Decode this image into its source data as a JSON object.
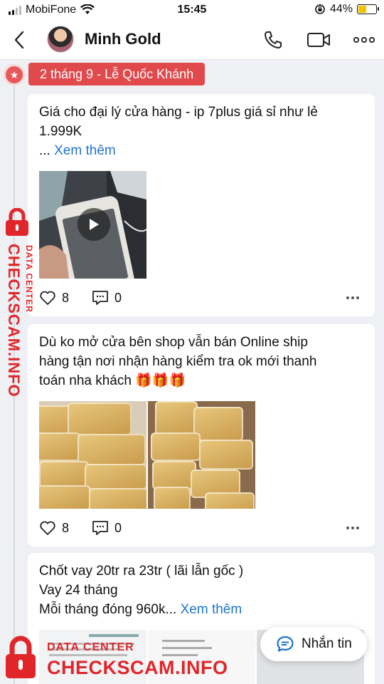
{
  "status_bar": {
    "carrier": "MobiFone",
    "time": "15:45",
    "battery": "44%"
  },
  "header": {
    "contact_name": "Minh Gold"
  },
  "timeline": {
    "date_label": "2 tháng 9 - Lễ Quốc Khánh"
  },
  "posts": [
    {
      "text_line1": "Giá cho đại lý cửa hàng - ip 7plus giá sỉ như lẻ",
      "text_line2": "1.999K",
      "ellipsis": "... ",
      "see_more": "Xem thêm",
      "likes": "8",
      "comments": "0"
    },
    {
      "text_line1": "Dù ko mở cửa bên shop vẫn bán Online ship",
      "text_line2": "hàng tận nơi nhận hàng kiểm tra ok mới thanh",
      "text_line3": "toán nha khách 🎁🎁🎁",
      "likes": "8",
      "comments": "0"
    },
    {
      "text_line1": "Chốt  vay 20tr ra 23tr ( lãi lẫn gốc )",
      "text_line2": "Vay 24 tháng",
      "text_line3": "Mỗi tháng đóng 960k... ",
      "see_more": "Xem thêm"
    }
  ],
  "fab": {
    "label": "Nhắn tin"
  },
  "watermark": {
    "small": "DATA CENTER",
    "big": "CHECKSCAM.INFO"
  },
  "colors": {
    "accent_red": "#e14a4d",
    "link_blue": "#1f74cf",
    "watermark_red": "#e0262b"
  },
  "icons": [
    "back-icon",
    "phone-icon",
    "video-call-icon",
    "more-icon",
    "star-icon",
    "play-icon",
    "heart-icon",
    "comment-icon",
    "chat-icon",
    "lock-icon"
  ]
}
